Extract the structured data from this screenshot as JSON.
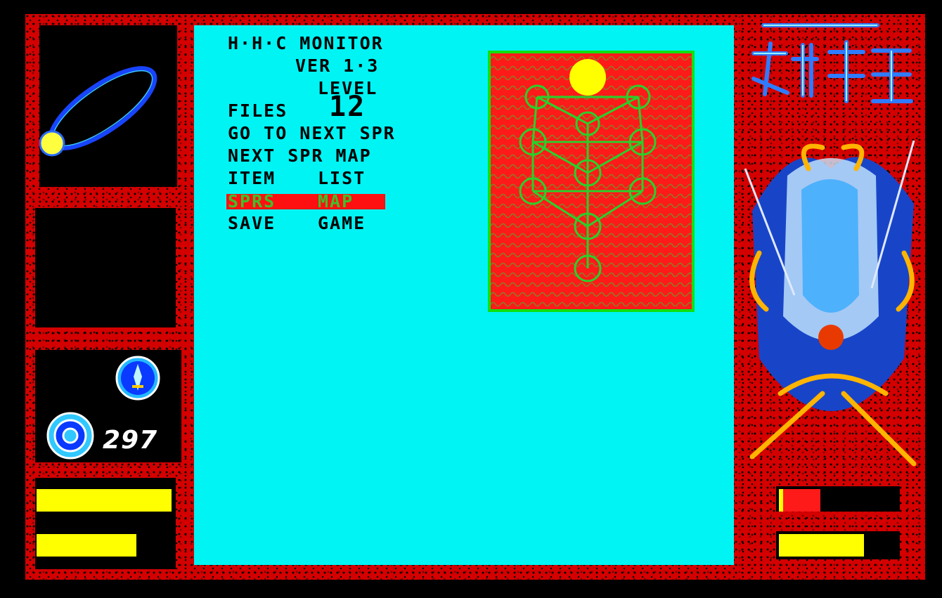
{
  "monitor": {
    "title": "H·H·C MONITOR",
    "version": "VER 1·3",
    "level_label": "LEVEL",
    "menu": {
      "files_label": "FILES",
      "level_value": "12",
      "go_to_next": "GO TO NEXT SPR",
      "next_map": "NEXT SPR MAP",
      "item": "ITEM",
      "list": "LIST",
      "sprs": "SPRS",
      "map": "MAP",
      "save": "SAVE",
      "game": "GAME"
    }
  },
  "status": {
    "counter": "297",
    "player_bars": [
      1.0,
      0.74
    ],
    "enemy_bars": [
      0.35,
      0.72
    ]
  },
  "colors": {
    "monitor_bg": "#00f4f4",
    "frame": "#d40000",
    "bar_yellow": "#ffff00",
    "selection": "#ff1010",
    "map_green": "#10e010"
  },
  "icons": [
    "orbit-ring-icon",
    "sword-emblem-icon",
    "compass-coin-icon",
    "game-title-logo",
    "demon-portrait"
  ]
}
